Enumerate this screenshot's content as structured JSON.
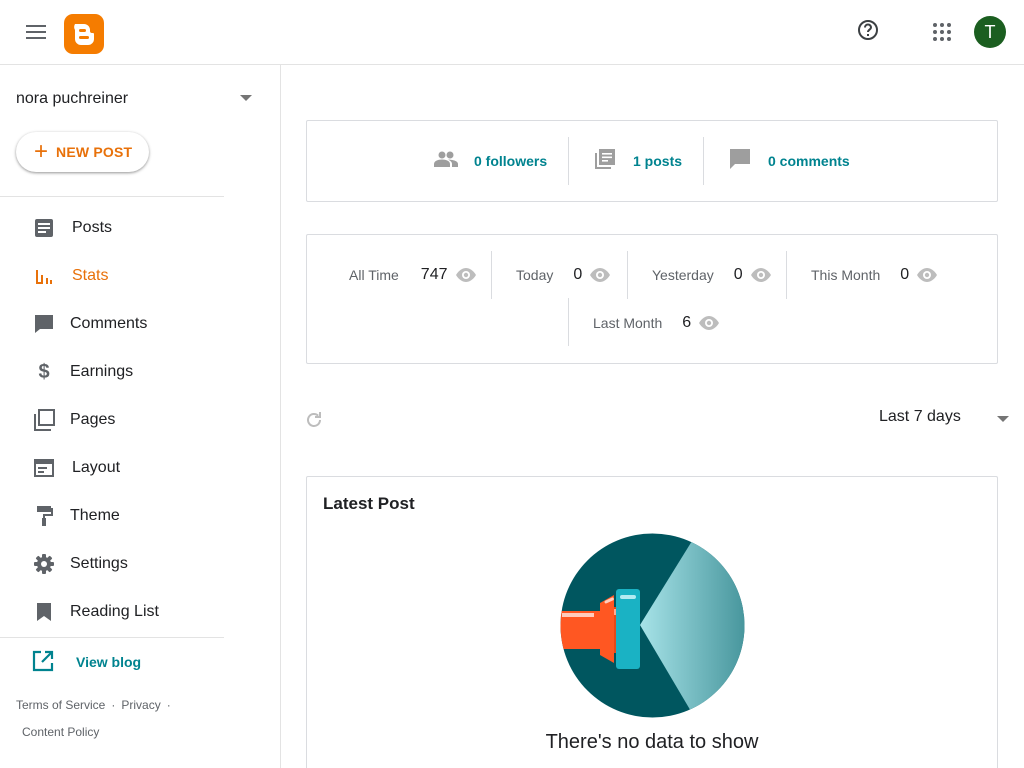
{
  "header": {
    "menu_icon": "hamburger-menu-icon",
    "logo_icon": "blogger-logo-icon",
    "help_icon": "help-icon",
    "apps_icon": "apps-grid-icon",
    "avatar_initial": "T",
    "avatar_color": "#1b5e20",
    "brand_color": "#f57c00"
  },
  "sidebar": {
    "blog_name": "nora puchreiner",
    "new_post_label": "NEW POST",
    "items": [
      {
        "label": "Posts",
        "icon": "posts-icon"
      },
      {
        "label": "Stats",
        "icon": "stats-icon",
        "active": true
      },
      {
        "label": "Comments",
        "icon": "comments-icon"
      },
      {
        "label": "Earnings",
        "icon": "dollar-icon"
      },
      {
        "label": "Pages",
        "icon": "pages-icon"
      },
      {
        "label": "Layout",
        "icon": "layout-icon"
      },
      {
        "label": "Theme",
        "icon": "paint-roller-icon"
      },
      {
        "label": "Settings",
        "icon": "gear-icon"
      },
      {
        "label": "Reading List",
        "icon": "bookmark-icon"
      }
    ],
    "view_blog_label": "View blog",
    "footer": {
      "terms": "Terms of Service",
      "privacy": "Privacy",
      "content_policy": "Content Policy"
    }
  },
  "summary": {
    "followers": "0 followers",
    "posts": "1 posts",
    "comments": "0 comments"
  },
  "stats": {
    "all_time": {
      "label": "All Time",
      "value": "747"
    },
    "today": {
      "label": "Today",
      "value": "0"
    },
    "yesterday": {
      "label": "Yesterday",
      "value": "0"
    },
    "this_month": {
      "label": "This Month",
      "value": "0"
    },
    "last_month": {
      "label": "Last Month",
      "value": "6"
    }
  },
  "range": {
    "selected": "Last 7 days"
  },
  "latest_post": {
    "title": "Latest Post",
    "empty_message": "There's no data to show"
  },
  "colors": {
    "accent": "#e8710a",
    "link": "#00838f",
    "illustration_dark": "#00565f"
  }
}
